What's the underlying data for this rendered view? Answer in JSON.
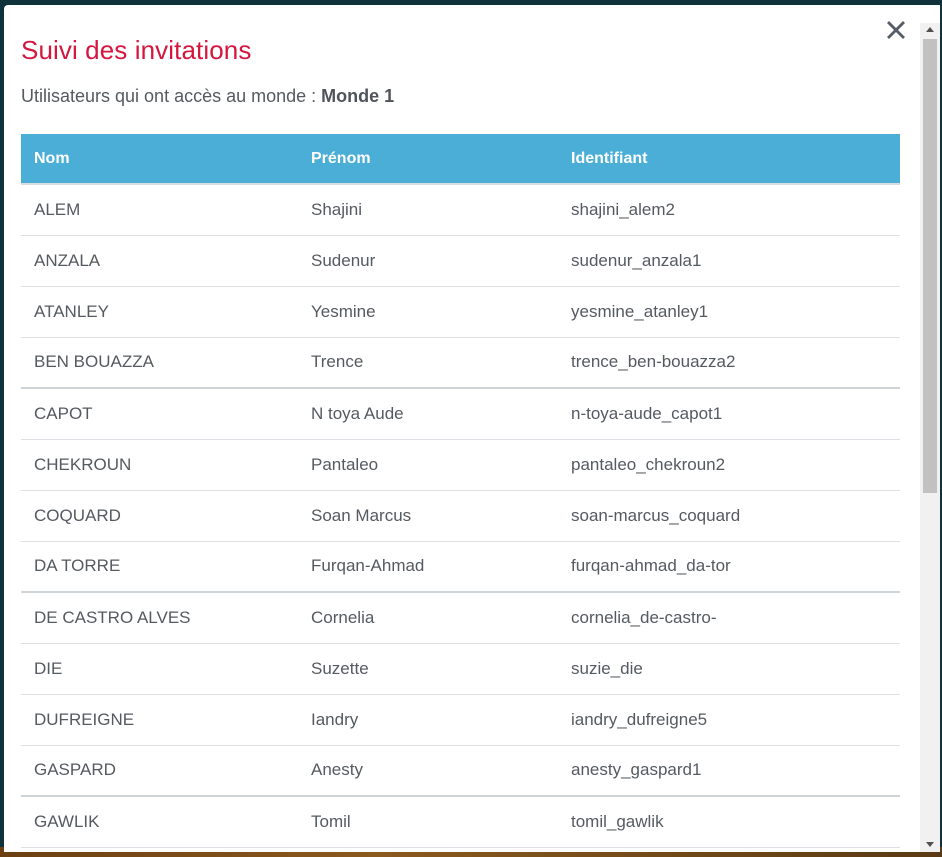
{
  "modal": {
    "title": "Suivi des invitations",
    "subtitle_prefix": "Utilisateurs qui ont accès au monde : ",
    "world_name": "Monde 1",
    "close_icon": "close-icon"
  },
  "table": {
    "columns": [
      "Nom",
      "Prénom",
      "Identifiant"
    ],
    "rows": [
      {
        "nom": "ALEM",
        "prenom": "Shajini",
        "identifiant": "shajini_alem2"
      },
      {
        "nom": "ANZALA",
        "prenom": "Sudenur",
        "identifiant": "sudenur_anzala1"
      },
      {
        "nom": "ATANLEY",
        "prenom": "Yesmine",
        "identifiant": "yesmine_atanley1"
      },
      {
        "nom": "BEN BOUAZZA",
        "prenom": "Trence",
        "identifiant": "trence_ben-bouazza2"
      },
      {
        "nom": "CAPOT",
        "prenom": "N toya Aude",
        "identifiant": "n-toya-aude_capot1"
      },
      {
        "nom": "CHEKROUN",
        "prenom": "Pantaleo",
        "identifiant": "pantaleo_chekroun2"
      },
      {
        "nom": "COQUARD",
        "prenom": "Soan Marcus",
        "identifiant": "soan-marcus_coquard"
      },
      {
        "nom": "DA TORRE",
        "prenom": "Furqan-Ahmad",
        "identifiant": "furqan-ahmad_da-tor"
      },
      {
        "nom": "DE CASTRO ALVES",
        "prenom": "Cornelia",
        "identifiant": "cornelia_de-castro-"
      },
      {
        "nom": "DIE",
        "prenom": "Suzette",
        "identifiant": "suzie_die"
      },
      {
        "nom": "DUFREIGNE",
        "prenom": "Iandry",
        "identifiant": "iandry_dufreigne5"
      },
      {
        "nom": "GASPARD",
        "prenom": "Anesty",
        "identifiant": "anesty_gaspard1"
      },
      {
        "nom": "GAWLIK",
        "prenom": "Tomil",
        "identifiant": "tomil_gawlik"
      }
    ]
  },
  "colors": {
    "title": "#d5163f",
    "header_bg": "#4aaed6",
    "text": "#555a60"
  }
}
